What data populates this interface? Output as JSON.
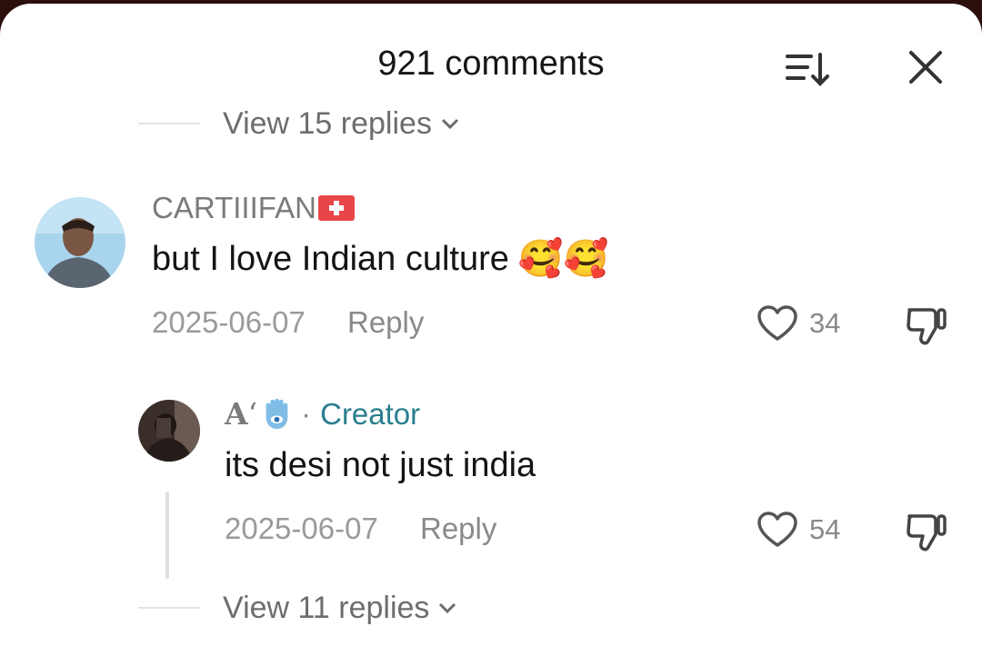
{
  "header": {
    "title": "921 comments",
    "sort_icon": "sort-icon",
    "close_icon": "close-icon"
  },
  "top_view_replies": {
    "label": "View 15 replies"
  },
  "comments": [
    {
      "username": "CARTIIIFAN",
      "flag_icon": "swiss-flag-icon",
      "text": "but I love Indian culture",
      "emoji": "🥰🥰",
      "date": "2025-06-07",
      "reply_label": "Reply",
      "likes": "34"
    },
    {
      "username": "A",
      "username_glyph": "‘",
      "hamsa_icon": "hamsa-icon",
      "separator": "·",
      "badge": "Creator",
      "text": "its desi not just india",
      "date": "2025-06-07",
      "reply_label": "Reply",
      "likes": "54"
    }
  ],
  "bottom_view_replies": {
    "label": "View 11 replies"
  },
  "colors": {
    "creator": "#2a7f8f",
    "text": "#141414",
    "muted": "#9a9a9a"
  }
}
